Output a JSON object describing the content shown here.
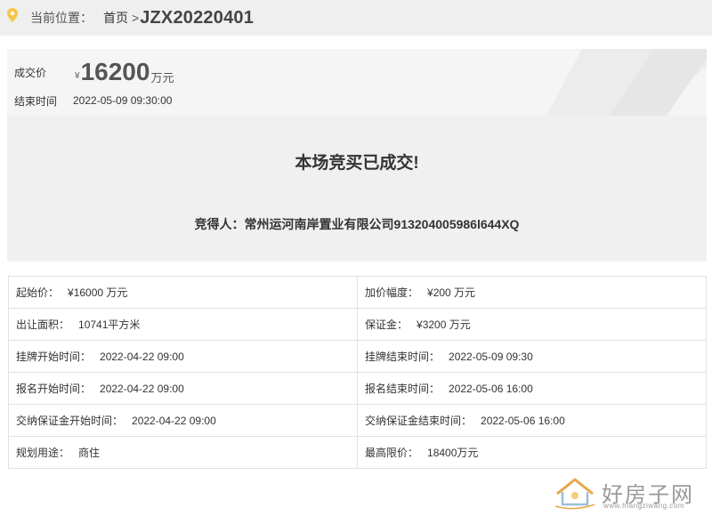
{
  "breadcrumb": {
    "label": "当前位置：",
    "home": "首页",
    "separator": ">",
    "current": "JZX20220401"
  },
  "price": {
    "deal_label": "成交价",
    "currency_symbol": "¥",
    "deal_value": "16200",
    "deal_unit": "万元",
    "end_label": "结束时间",
    "end_value": "2022-05-09 09:30:00"
  },
  "result": {
    "title": "本场竞买已成交!",
    "winner": "竞得人：常州运河南岸置业有限公司913204005986l644XQ"
  },
  "details": [
    [
      {
        "label": "起始价：",
        "value": "¥16000 万元"
      },
      {
        "label": "加价幅度：",
        "value": "¥200 万元"
      }
    ],
    [
      {
        "label": "出让面积：",
        "value": "10741平方米"
      },
      {
        "label": "保证金：",
        "value": "¥3200 万元"
      }
    ],
    [
      {
        "label": "挂牌开始时间：",
        "value": "2022-04-22 09:00"
      },
      {
        "label": "挂牌结束时间：",
        "value": "2022-05-09 09:30"
      }
    ],
    [
      {
        "label": "报名开始时间：",
        "value": "2022-04-22 09:00"
      },
      {
        "label": "报名结束时间：",
        "value": "2022-05-06 16:00"
      }
    ],
    [
      {
        "label": "交纳保证金开始时间：",
        "value": "2022-04-22 09:00"
      },
      {
        "label": "交纳保证金结束时间：",
        "value": "2022-05-06 16:00"
      }
    ],
    [
      {
        "label": "规划用途：",
        "value": "商住"
      },
      {
        "label": "最高限价：",
        "value": "18400万元"
      }
    ]
  ],
  "watermark": {
    "name": "好房子网",
    "url": "www.hfangziwang.com"
  },
  "icons": {
    "location": "location-pin-icon",
    "watermark_logo": "house-logo-icon"
  },
  "colors": {
    "pin": "#f5c64a",
    "panel_bg": "#f0f0f0",
    "crumb_bg": "#efefef"
  }
}
